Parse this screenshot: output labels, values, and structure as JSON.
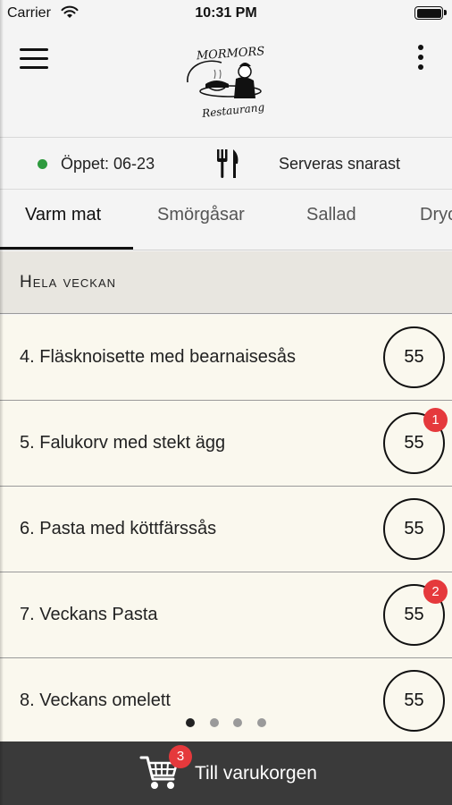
{
  "status_bar": {
    "carrier": "Carrier",
    "time": "10:31 PM"
  },
  "header": {
    "logo_text_top": "MORMORS",
    "logo_text_bottom": "Restaurang"
  },
  "info": {
    "open_label": "Öppet: 06-23",
    "serve_label": "Serveras snarast",
    "open_color": "#2e9a3e"
  },
  "tabs": [
    {
      "label": "Varm mat",
      "active": true
    },
    {
      "label": "Smörgåsar",
      "active": false
    },
    {
      "label": "Sallad",
      "active": false
    },
    {
      "label": "Dryck",
      "active": false
    }
  ],
  "section": {
    "title": "Hela veckan"
  },
  "items": [
    {
      "name": "4. Fläsknoisette med bearnaisesås",
      "price": "55",
      "badge": ""
    },
    {
      "name": "5. Falukorv med stekt ägg",
      "price": "55",
      "badge": "1"
    },
    {
      "name": "6. Pasta med köttfärssås",
      "price": "55",
      "badge": ""
    },
    {
      "name": "7. Veckans Pasta",
      "price": "55",
      "badge": "2"
    },
    {
      "name": "8. Veckans omelett",
      "price": "55",
      "badge": ""
    }
  ],
  "pager": {
    "count": 4,
    "active_index": 0
  },
  "cart": {
    "label": "Till varukorgen",
    "count": "3"
  },
  "colors": {
    "accent_badge": "#e5393c",
    "cart_bar": "#3a3a3a",
    "list_background": "#faf8ee"
  }
}
